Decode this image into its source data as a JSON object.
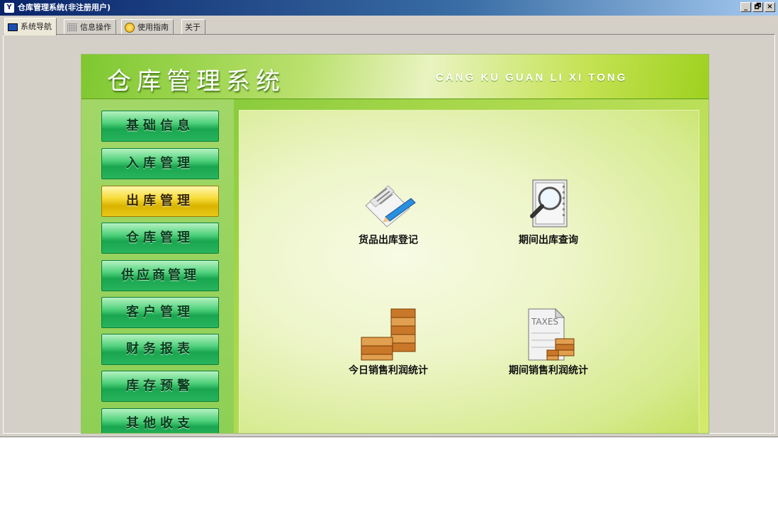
{
  "window": {
    "title": "仓库管理系统(非注册用户)",
    "controls": [
      "_",
      "🗗",
      "×"
    ]
  },
  "tabs": [
    {
      "label": "系统导航",
      "icon": "nav-icon",
      "active": true
    },
    {
      "label": "信息操作",
      "icon": "grid-icon",
      "active": false
    },
    {
      "label": "使用指南",
      "icon": "help-icon",
      "active": false
    },
    {
      "label": "关于",
      "icon": "",
      "active": false
    }
  ],
  "app": {
    "title": "仓库管理系统",
    "subtitle": "CANG KU GUAN LI XI TONG"
  },
  "menu": [
    {
      "label": "基础信息",
      "active": false
    },
    {
      "label": "入库管理",
      "active": false
    },
    {
      "label": "出库管理",
      "active": true
    },
    {
      "label": "仓库管理",
      "active": false
    },
    {
      "label": "供应商管理",
      "active": false
    },
    {
      "label": "客户管理",
      "active": false
    },
    {
      "label": "财务报表",
      "active": false
    },
    {
      "label": "库存预警",
      "active": false
    },
    {
      "label": "其他收支",
      "active": false
    }
  ],
  "features": [
    {
      "label": "货品出库登记",
      "icon": "document-pen-icon"
    },
    {
      "label": "期间出库查询",
      "icon": "magnifier-document-icon"
    },
    {
      "label": "今日销售利润统计",
      "icon": "coin-stacks-icon"
    },
    {
      "label": "期间销售利润统计",
      "icon": "taxes-document-icon",
      "icon_text": "TAXES"
    }
  ],
  "colors": {
    "accent_green": "#1aa650",
    "active_yellow": "#f7dc3a",
    "title_bar": "#0a246a"
  }
}
